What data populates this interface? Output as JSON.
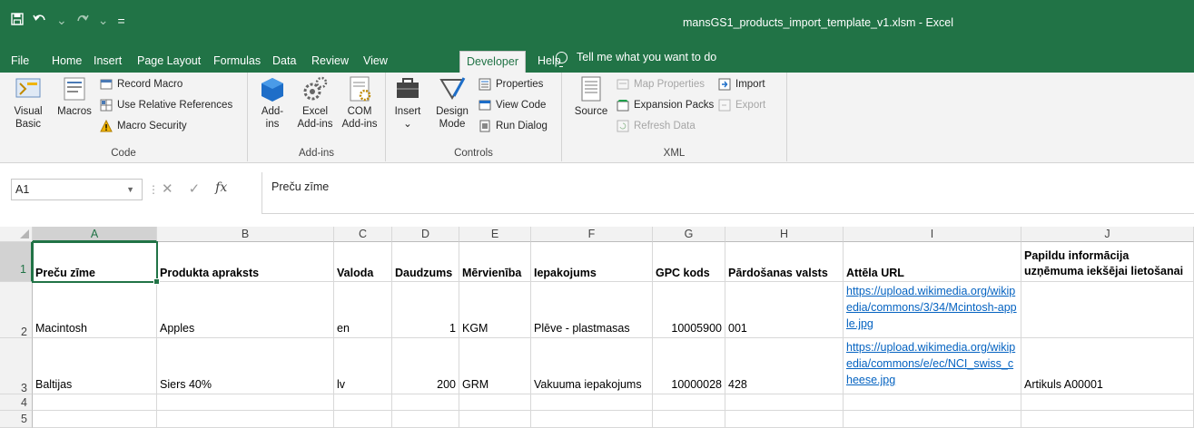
{
  "window": {
    "title": "mansGS1_products_import_template_v1.xlsm  -  Excel",
    "qat": {
      "save_icon": "save-icon",
      "undo_icon": "undo-icon",
      "redo_icon": "redo-icon",
      "customize": "="
    }
  },
  "tabs": [
    "File",
    "Home",
    "Insert",
    "Page Layout",
    "Formulas",
    "Data",
    "Review",
    "View",
    "Developer",
    "Help"
  ],
  "active_tab": "Developer",
  "tell_me": "Tell me what you want to do",
  "ribbon": {
    "code": {
      "label": "Code",
      "visual_basic": [
        "Visual",
        "Basic"
      ],
      "macros": "Macros",
      "record_macro": "Record Macro",
      "use_relative": "Use Relative References",
      "macro_security": "Macro Security"
    },
    "addins": {
      "label": "Add-ins",
      "addins": [
        "Add-",
        "ins"
      ],
      "excel_addins": [
        "Excel",
        "Add-ins"
      ],
      "com_addins": [
        "COM",
        "Add-ins"
      ]
    },
    "controls": {
      "label": "Controls",
      "insert": "Insert",
      "design_mode": [
        "Design",
        "Mode"
      ],
      "properties": "Properties",
      "view_code": "View Code",
      "run_dialog": "Run Dialog"
    },
    "xml": {
      "label": "XML",
      "source": "Source",
      "map_properties": "Map Properties",
      "expansion_packs": "Expansion Packs",
      "refresh_data": "Refresh Data",
      "import": "Import",
      "export": "Export"
    }
  },
  "formula_bar": {
    "name_box": "A1",
    "cancel": "✕",
    "enter": "✓",
    "fx": "fx",
    "value": "Preču zīme"
  },
  "sheet": {
    "columns": [
      "A",
      "B",
      "C",
      "D",
      "E",
      "F",
      "G",
      "H",
      "I",
      "J"
    ],
    "rows": [
      "1",
      "2",
      "3",
      "4",
      "5"
    ],
    "headers": [
      "Preču zīme",
      "Produkta apraksts",
      "Valoda",
      "Daudzums",
      "Mērvienība",
      "Iepakojums",
      "GPC kods",
      "Pārdošanas valsts",
      "Attēla URL",
      "Papildu informācija uzņēmuma iekšējai lietošanai"
    ],
    "data": [
      [
        "Macintosh",
        "Apples",
        "en",
        "1",
        "KGM",
        "Plēve - plastmasas",
        "10005900",
        "001",
        "https://upload.wikimedia.org/wikipedia/commons/3/34/Mcintosh-apple.jpg",
        ""
      ],
      [
        "Baltijas",
        "Siers 40%",
        "lv",
        "200",
        "GRM",
        "Vakuuma iepakojums",
        "10000028",
        "428",
        "https://upload.wikimedia.org/wikipedia/commons/e/ec/NCI_swiss_cheese.jpg",
        "Artikuls A00001"
      ]
    ]
  },
  "colors": {
    "excel_green": "#217346",
    "link": "#0563c1"
  }
}
